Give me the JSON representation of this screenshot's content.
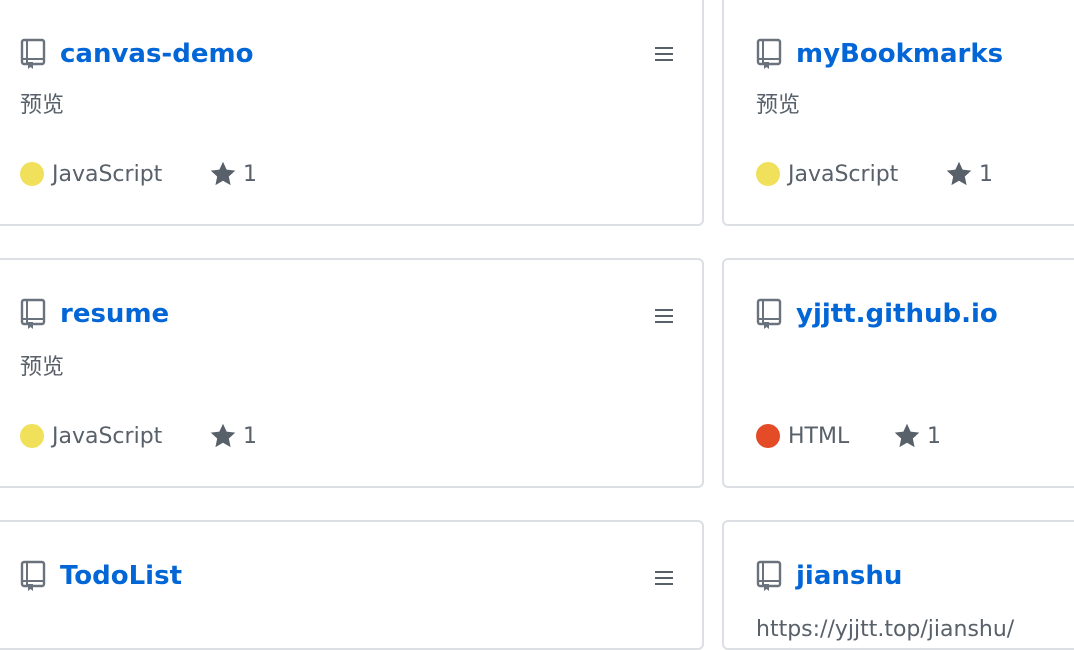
{
  "repos": [
    {
      "name": "canvas-demo",
      "description": "预览",
      "language": "JavaScript",
      "language_color": "#f1e05a",
      "stars": "1"
    },
    {
      "name": "myBookmarks",
      "description": "预览",
      "language": "JavaScript",
      "language_color": "#f1e05a",
      "stars": "1"
    },
    {
      "name": "resume",
      "description": "预览",
      "language": "JavaScript",
      "language_color": "#f1e05a",
      "stars": "1"
    },
    {
      "name": "yjjtt.github.io",
      "description": "",
      "language": "HTML",
      "language_color": "#e34c26",
      "stars": "1"
    },
    {
      "name": "TodoList",
      "description": "",
      "language": "",
      "language_color": "",
      "stars": ""
    },
    {
      "name": "jianshu",
      "description": "https://yjjtt.top/jianshu/",
      "language": "",
      "language_color": "",
      "stars": ""
    }
  ],
  "colors": {
    "link": "#0366d6",
    "muted": "#586069",
    "border": "#dcdfe3",
    "javascript": "#f1e05a",
    "html": "#e34c26"
  },
  "icons": {
    "repo": "repo-icon",
    "menu": "menu-icon",
    "star": "star-icon"
  }
}
